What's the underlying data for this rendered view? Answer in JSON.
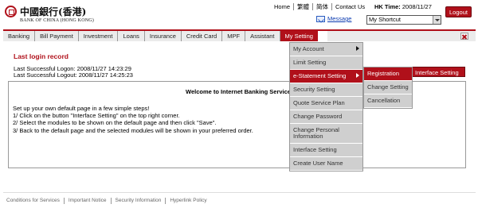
{
  "brand": {
    "name_cn": "中國銀行(香港)",
    "name_en": "BANK OF CHINA (HONG KONG)"
  },
  "toplinks": [
    "Home",
    "繁體",
    "简体",
    "Contact Us"
  ],
  "hk_time": {
    "label": "HK Time:",
    "value": "2008/11/27"
  },
  "logout_label": "Logout",
  "message_label": "Message",
  "shortcut": {
    "selected": "My Shortcut"
  },
  "nav": [
    "Banking",
    "Bill Payment",
    "Investment",
    "Loans",
    "Insurance",
    "Credit Card",
    "MPF",
    "Assistant",
    "My Setting"
  ],
  "last_login": {
    "title": "Last login record",
    "logon": "Last Successful Logon: 2008/11/27 14:23:29",
    "logoff": "Last Successful Logout: 2008/11/27 14:25:23"
  },
  "welcome": "Welcome to Internet Banking Service",
  "steps": [
    "Set up your own default page in a few simple steps!",
    "1/ Click on the button \"Interface Setting\" on the top right corner.",
    "2/ Select the modules to be shown on the default page and then click \"Save\".",
    "3/ Back to the default page and the selected modules will be shown in your preferred order."
  ],
  "interface_setting_tab": "Interface Setting",
  "my_setting_menu": [
    "My Account",
    "Limit Setting",
    "e-Statement Setting",
    "Security Setting",
    "Quote Service Plan",
    "Change Password",
    "Change Personal Information",
    "Interface Setting",
    "Create User Name"
  ],
  "estatement_submenu": [
    "Registration",
    "Change Setting",
    "Cancellation"
  ],
  "footer": [
    "Conditions for Services",
    "Important Notice",
    "Security Information",
    "Hyperlink Policy"
  ],
  "colors": {
    "brand_red": "#b0101a",
    "menu_grey": "#cfcfcf",
    "link_blue": "#0c3bb0"
  }
}
